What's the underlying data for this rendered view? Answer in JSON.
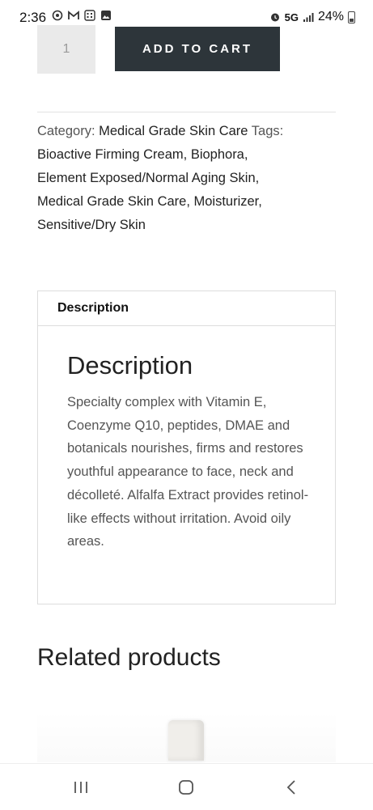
{
  "status_bar": {
    "time": "2:36",
    "network": "5G",
    "battery": "24%"
  },
  "cart": {
    "quantity": "1",
    "add_to_cart_label": "ADD TO CART"
  },
  "meta": {
    "category_label": "Category:",
    "category": "Medical Grade Skin Care",
    "tags_label": "Tags:",
    "tags": [
      "Bioactive Firming Cream",
      "Biophora",
      "Element Exposed/Normal Aging Skin",
      "Medical Grade Skin Care",
      "Moisturizer",
      "Sensitive/Dry Skin"
    ]
  },
  "description": {
    "tab_label": "Description",
    "heading": "Description",
    "text": "Specialty complex with Vitamin E, Coenzyme Q10, peptides, DMAE and botanicals nourishes, firms and restores youthful appearance to face, neck and décolleté. Alfalfa Extract provides retinol-like effects without irritation. Avoid oily areas."
  },
  "related": {
    "heading": "Related products"
  },
  "icons": {
    "recents": "recents-icon",
    "home": "home-icon",
    "back": "back-icon"
  }
}
